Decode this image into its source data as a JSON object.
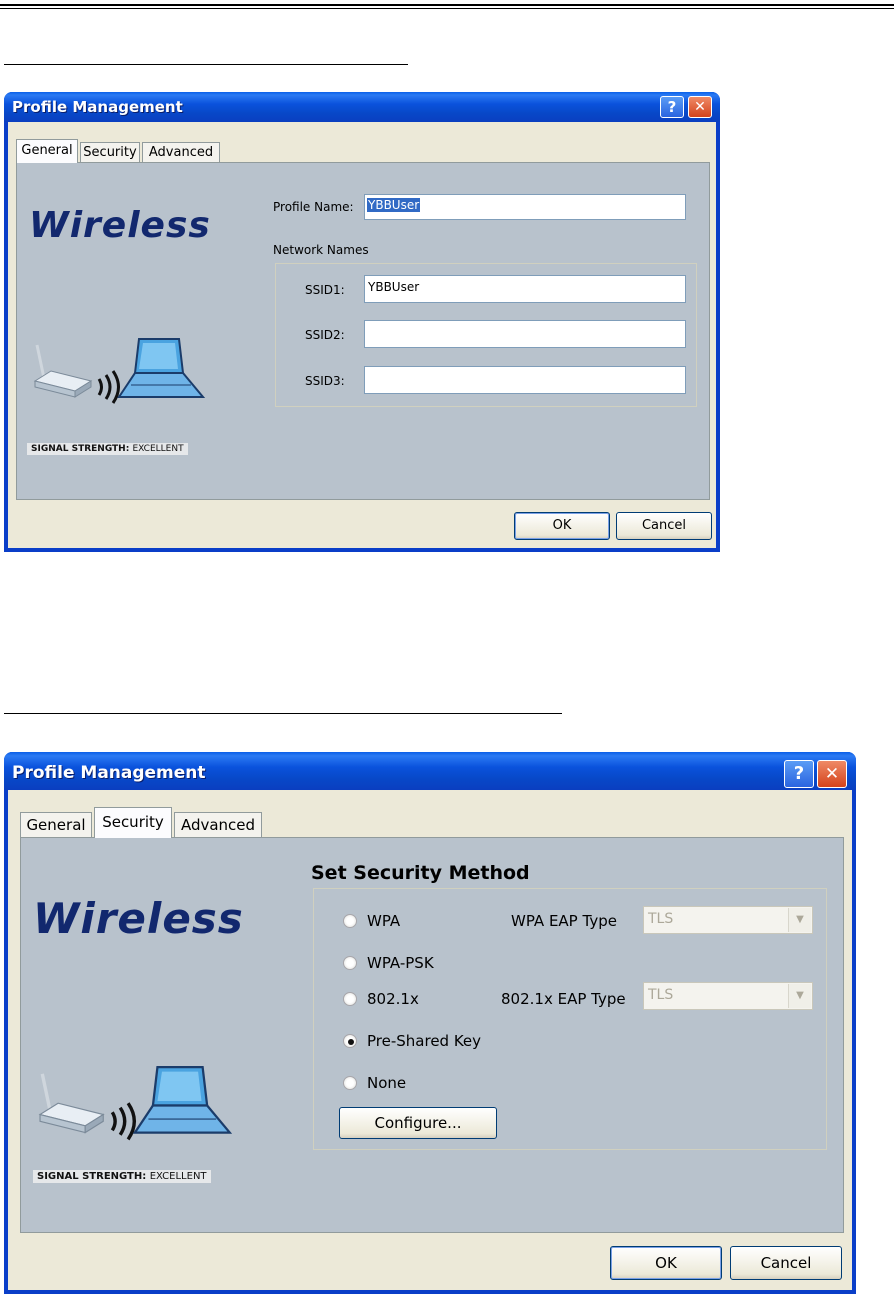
{
  "dialog1": {
    "title": "Profile Management",
    "help_glyph": "?",
    "close_glyph": "✕",
    "tabs": [
      "General",
      "Security",
      "Advanced"
    ],
    "brand": "Wireless",
    "signal_label": "SIGNAL STRENGTH:",
    "signal_value": "EXCELLENT",
    "profile_name_label": "Profile Name:",
    "profile_name_value": "YBBUser",
    "network_names_label": "Network Names",
    "ssid1_label": "SSID1:",
    "ssid1_value": "YBBUser",
    "ssid2_label": "SSID2:",
    "ssid2_value": "",
    "ssid3_label": "SSID3:",
    "ssid3_value": "",
    "ok_label": "OK",
    "cancel_label": "Cancel"
  },
  "dialog2": {
    "title": "Profile Management",
    "help_glyph": "?",
    "close_glyph": "✕",
    "tabs": [
      "General",
      "Security",
      "Advanced"
    ],
    "brand": "Wireless",
    "signal_label": "SIGNAL STRENGTH:",
    "signal_value": "EXCELLENT",
    "heading": "Set Security Method",
    "options": [
      "WPA",
      "WPA-PSK",
      "802.1x",
      "Pre-Shared Key",
      "None"
    ],
    "selected_option": "Pre-Shared Key",
    "wpa_eap_label": "WPA EAP Type",
    "wpa_eap_value": "TLS",
    "dot1x_eap_label": "802.1x EAP Type",
    "dot1x_eap_value": "TLS",
    "configure_label": "Configure...",
    "ok_label": "OK",
    "cancel_label": "Cancel"
  }
}
